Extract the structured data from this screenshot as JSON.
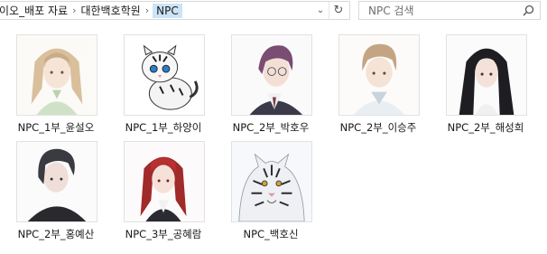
{
  "breadcrumb": {
    "items": [
      "이오_배포 자료",
      "대한백호학원",
      "NPC"
    ]
  },
  "search": {
    "placeholder": "NPC 검색"
  },
  "files": [
    {
      "label": "NPC_1부_윤설오",
      "icon": "blonde-character-thumbnail"
    },
    {
      "label": "NPC_1부_하양이",
      "icon": "white-tiger-cub-thumbnail"
    },
    {
      "label": "NPC_2부_박호우",
      "icon": "purple-hair-glasses-character-thumbnail"
    },
    {
      "label": "NPC_2부_이승주",
      "icon": "light-brown-hair-character-thumbnail"
    },
    {
      "label": "NPC_2부_해성희",
      "icon": "black-long-hair-character-thumbnail"
    },
    {
      "label": "NPC_2부_홍예산",
      "icon": "dark-hair-character-thumbnail"
    },
    {
      "label": "NPC_3부_공혜람",
      "icon": "red-hair-character-thumbnail"
    },
    {
      "label": "NPC_백호신",
      "icon": "white-tiger-thumbnail"
    }
  ]
}
